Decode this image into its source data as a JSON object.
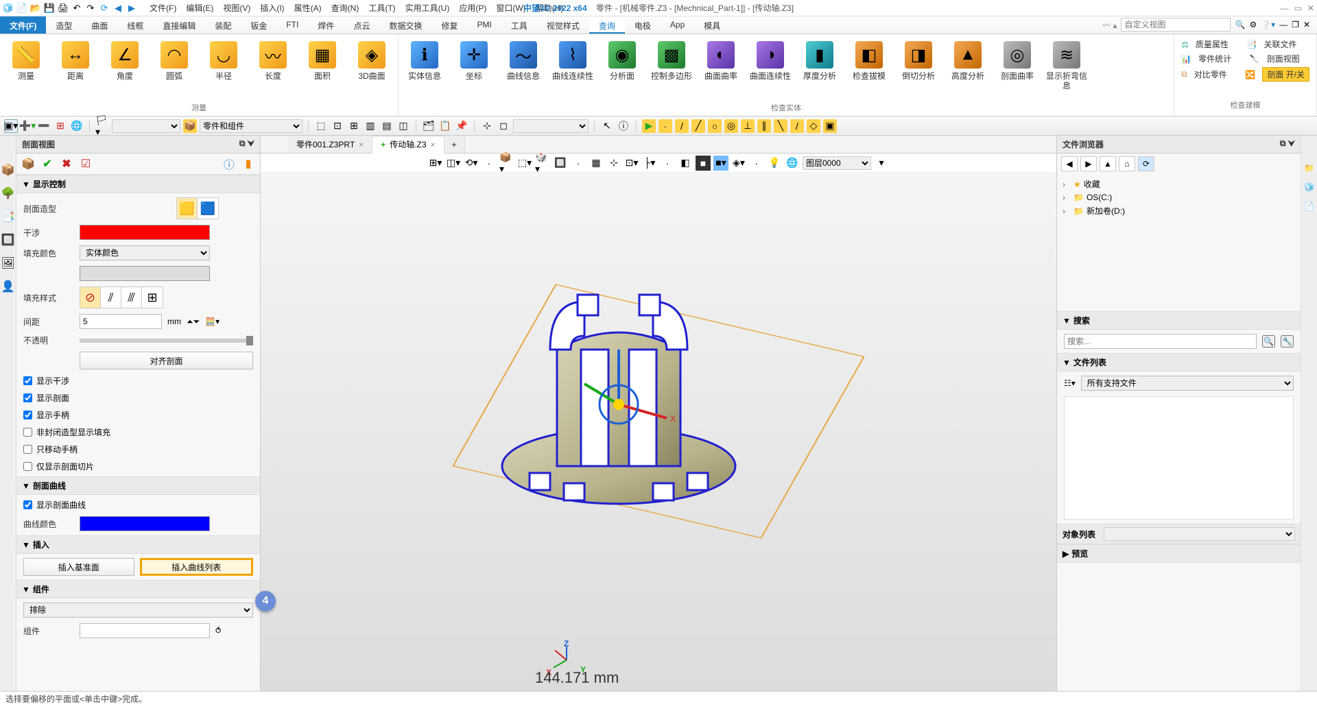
{
  "title": {
    "app": "中望3D 2022 x64",
    "doc": "零件 - [机械零件.Z3 - [Mechnical_Part-1]] - [传动轴.Z3]"
  },
  "menu": [
    "文件(F)",
    "编辑(E)",
    "视图(V)",
    "插入(I)",
    "属性(A)",
    "查询(N)",
    "工具(T)",
    "实用工具(U)",
    "应用(P)",
    "窗口(W)",
    "帮助(H)"
  ],
  "ribbon": {
    "tabs": [
      "文件(F)",
      "造型",
      "曲面",
      "线框",
      "直接编辑",
      "装配",
      "钣金",
      "FTI",
      "焊件",
      "点云",
      "数据交换",
      "修复",
      "PMI",
      "工具",
      "视觉样式",
      "查询",
      "电极",
      "App",
      "模具"
    ],
    "active": "查询",
    "search_placeholder": "自定义视图",
    "groups": {
      "measure": {
        "caption": "测量",
        "items": [
          "测量",
          "距离",
          "角度",
          "圆弧",
          "半径",
          "长度",
          "面积",
          "3D曲面"
        ]
      },
      "inspect": {
        "caption": "检查实体",
        "items": [
          "实体信息",
          "坐标",
          "曲线信息",
          "曲线连续性",
          "分析面",
          "控制多边形",
          "曲面曲率",
          "曲面连续性",
          "厚度分析",
          "检查拔模",
          "倒切分析",
          "高度分析",
          "剖面曲率",
          "显示折弯信息"
        ]
      },
      "model_check": {
        "caption": "检查建模",
        "rows": [
          [
            "质量属性",
            "关联文件"
          ],
          [
            "零件统计",
            "剖面视图"
          ],
          [
            "对比零件",
            "剖面 开/关"
          ]
        ]
      }
    }
  },
  "sub_toolbar": {
    "combo1": "",
    "combo2": "零件和组件"
  },
  "left_panel": {
    "title": "剖面视图",
    "sections": {
      "display": {
        "title": "显示控制",
        "section_type": "剖面造型",
        "interference": "干涉",
        "fill_color_label": "填充颜色",
        "fill_color_value": "实体颜色",
        "fill_style": "填充样式",
        "spacing_label": "间距",
        "spacing_value": "5",
        "spacing_unit": "mm",
        "opacity": "不透明",
        "align_btn": "对齐剖面",
        "checks": [
          "显示干涉",
          "显示剖面",
          "显示手柄",
          "非封闭造型显示填充",
          "只移动手柄",
          "仅显示剖面切片"
        ],
        "checks_state": [
          true,
          true,
          true,
          false,
          false,
          false
        ]
      },
      "curves": {
        "title": "剖面曲线",
        "show_curve": "显示剖面曲线",
        "curve_color": "曲线颜色"
      },
      "insert": {
        "title": "插入",
        "btn_datum": "插入基准面",
        "btn_curve": "插入曲线列表"
      },
      "component": {
        "title": "组件",
        "mode": "排除",
        "label": "组件"
      }
    }
  },
  "doc_tabs": [
    {
      "label": "零件001.Z3PRT",
      "active": false
    },
    {
      "label": "传动轴.Z3",
      "active": true,
      "prefix": "+"
    }
  ],
  "view_toolbar": {
    "layer": "图层0000"
  },
  "viewport": {
    "dimension": "144.171 mm",
    "triad": {
      "x": "X",
      "y": "Y",
      "z": "Z"
    }
  },
  "right_panel": {
    "title": "文件浏览器",
    "tree": [
      {
        "label": "收藏",
        "icon": "★",
        "color": "#f0a500"
      },
      {
        "label": "OS(C:)",
        "icon": "📁"
      },
      {
        "label": "新加卷(D:)",
        "icon": "📁"
      }
    ],
    "search": {
      "title": "搜索",
      "placeholder": "搜索..."
    },
    "files": {
      "title": "文件列表",
      "filter": "所有支持文件"
    },
    "objects": "对象列表",
    "preview": "预览"
  },
  "status": "选择要偏移的平面或<单击中键>完成。",
  "callout": "4"
}
